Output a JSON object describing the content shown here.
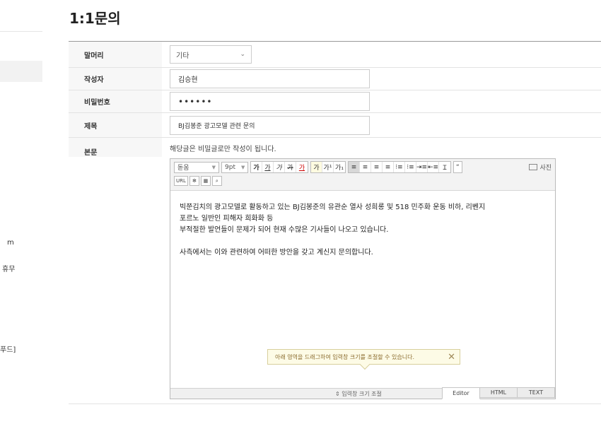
{
  "sidebar": {
    "fragments": [
      "m",
      "휴무",
      "푸드]"
    ]
  },
  "page": {
    "title": "1:1문의"
  },
  "form": {
    "header_label": "말머리",
    "header_value": "기타",
    "author_label": "작성자",
    "author_value": "김승현",
    "password_label": "비밀번호",
    "password_value": "••••••",
    "subject_label": "제목",
    "subject_value": "BJ김봉준 광고모델 관련 문의",
    "body_label": "본문",
    "body_notice": "해당글은 비밀글로만 작성이 됩니다."
  },
  "editor": {
    "font_family": "돋움",
    "font_size": "9pt",
    "format_buttons": [
      "가",
      "가",
      "가",
      "가",
      "가"
    ],
    "color_buttons": [
      "가",
      "가"
    ],
    "script_buttons": [
      "가¹",
      "가₁"
    ],
    "align_buttons": [
      "≡",
      "≡",
      "≡",
      "≡",
      "⁝≡",
      "⁝≡",
      "⇥≡",
      "⇤≡",
      "Ɪ"
    ],
    "quote_button": "“",
    "photo_label": "사진",
    "url_label": "URL",
    "content_lines": [
      "빅쭌김치의 광고모델로 활동하고 있는 BJ김봉준의 유관순 열사 성희롱 및 518 민주화 운동 비하, 리벤지",
      "포르노 일반인 피해자 희화화 등",
      "부적절한 발언들이 문제가 되어 현재 수많은 기사들이 나오고 있습니다.",
      "사측에서는 이와 관련하여 어떠한 방안을 갖고 계신지 문의합니다."
    ],
    "tooltip": "아래 영역을 드래그하여 입력창 크기를 조절할 수 있습니다.",
    "resize_label": "⇕ 입력창 크기 조절",
    "modes": [
      "Editor",
      "HTML",
      "TEXT"
    ]
  }
}
